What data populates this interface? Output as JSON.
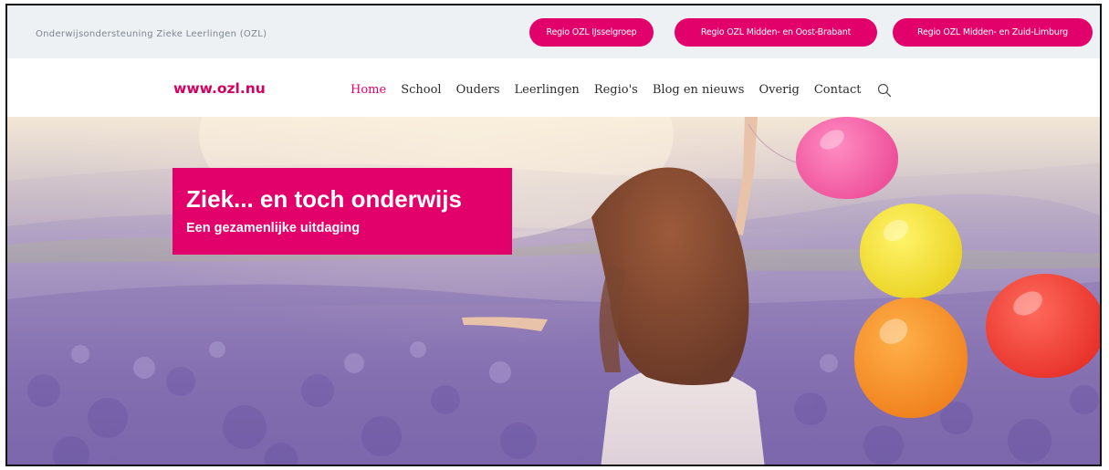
{
  "topbar": {
    "title": "Onderwijsondersteuning Zieke Leerlingen (OZL)",
    "regions": [
      {
        "label": "Regio OZL IJsselgroep"
      },
      {
        "label": "Regio OZL Midden- en Oost-Brabant"
      },
      {
        "label": "Regio OZL Midden- en Zuid-Limburg"
      }
    ]
  },
  "nav": {
    "logo": "www.ozl.nu",
    "items": [
      {
        "label": "Home"
      },
      {
        "label": "School"
      },
      {
        "label": "Ouders"
      },
      {
        "label": "Leerlingen"
      },
      {
        "label": "Regio's"
      },
      {
        "label": "Blog en nieuws"
      },
      {
        "label": "Overig"
      },
      {
        "label": "Contact"
      }
    ],
    "active_item": "Home",
    "search_icon": "search-icon"
  },
  "hero": {
    "title": "Ziek... en toch onderwijs",
    "subtitle": "Een gezamenlijke uitdaging",
    "image": "girl-in-lavender-field-with-balloons"
  },
  "colors": {
    "accent": "#e2006a",
    "topbar_bg": "#eef1f4",
    "lavender": "#8d78b8",
    "balloon_pink": "#f05aa0",
    "balloon_yellow": "#f5e428",
    "balloon_orange": "#f5901e",
    "balloon_red": "#f03a32"
  }
}
